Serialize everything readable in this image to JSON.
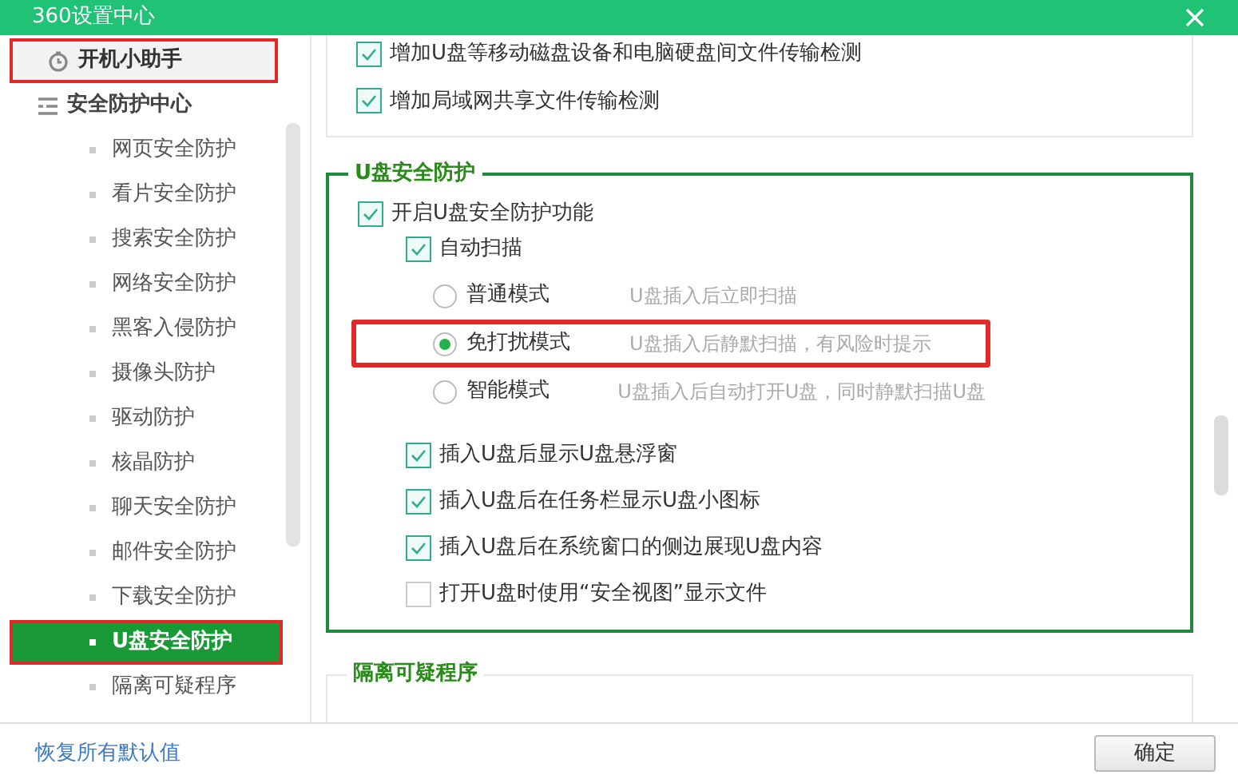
{
  "window": {
    "title": "360设置中心"
  },
  "sidebar": {
    "top_item": {
      "label": "开机小助手",
      "highlighted": true
    },
    "group": {
      "label": "安全防护中心",
      "items": [
        {
          "label": "网页安全防护",
          "selected": false,
          "highlighted": false
        },
        {
          "label": "看片安全防护",
          "selected": false,
          "highlighted": false
        },
        {
          "label": "搜索安全防护",
          "selected": false,
          "highlighted": false
        },
        {
          "label": "网络安全防护",
          "selected": false,
          "highlighted": false
        },
        {
          "label": "黑客入侵防护",
          "selected": false,
          "highlighted": false
        },
        {
          "label": "摄像头防护",
          "selected": false,
          "highlighted": false
        },
        {
          "label": "驱动防护",
          "selected": false,
          "highlighted": false
        },
        {
          "label": "核晶防护",
          "selected": false,
          "highlighted": false
        },
        {
          "label": "聊天安全防护",
          "selected": false,
          "highlighted": false
        },
        {
          "label": "邮件安全防护",
          "selected": false,
          "highlighted": false
        },
        {
          "label": "下载安全防护",
          "selected": false,
          "highlighted": false
        },
        {
          "label": "U盘安全防护",
          "selected": true,
          "highlighted": true
        },
        {
          "label": "隔离可疑程序",
          "selected": false,
          "highlighted": false
        }
      ]
    }
  },
  "previous_section": {
    "options": [
      {
        "label": "增加U盘等移动磁盘设备和电脑硬盘间文件传输检测",
        "checked": true
      },
      {
        "label": "增加局域网共享文件传输检测",
        "checked": true
      }
    ]
  },
  "usb_section": {
    "title": "U盘安全防护",
    "enable": {
      "label": "开启U盘安全防护功能",
      "checked": true
    },
    "auto_scan": {
      "label": "自动扫描",
      "checked": true
    },
    "modes": [
      {
        "label": "普通模式",
        "description": "U盘插入后立即扫描",
        "selected": false,
        "highlighted": false
      },
      {
        "label": "免打扰模式",
        "description": "U盘插入后静默扫描，有风险时提示",
        "selected": true,
        "highlighted": true
      },
      {
        "label": "智能模式",
        "description": "U盘插入后自动打开U盘，同时静默扫描U盘",
        "selected": false,
        "highlighted": false
      }
    ],
    "options": [
      {
        "label": "插入U盘后显示U盘悬浮窗",
        "checked": true
      },
      {
        "label": "插入U盘后在任务栏显示U盘小图标",
        "checked": true
      },
      {
        "label": "插入U盘后在系统窗口的侧边展现U盘内容",
        "checked": true
      },
      {
        "label": "打开U盘时使用“安全视图”显示文件",
        "checked": false
      }
    ]
  },
  "next_section": {
    "title": "隔离可疑程序"
  },
  "footer": {
    "restore_link": "恢复所有默认值",
    "ok_button": "确定"
  }
}
